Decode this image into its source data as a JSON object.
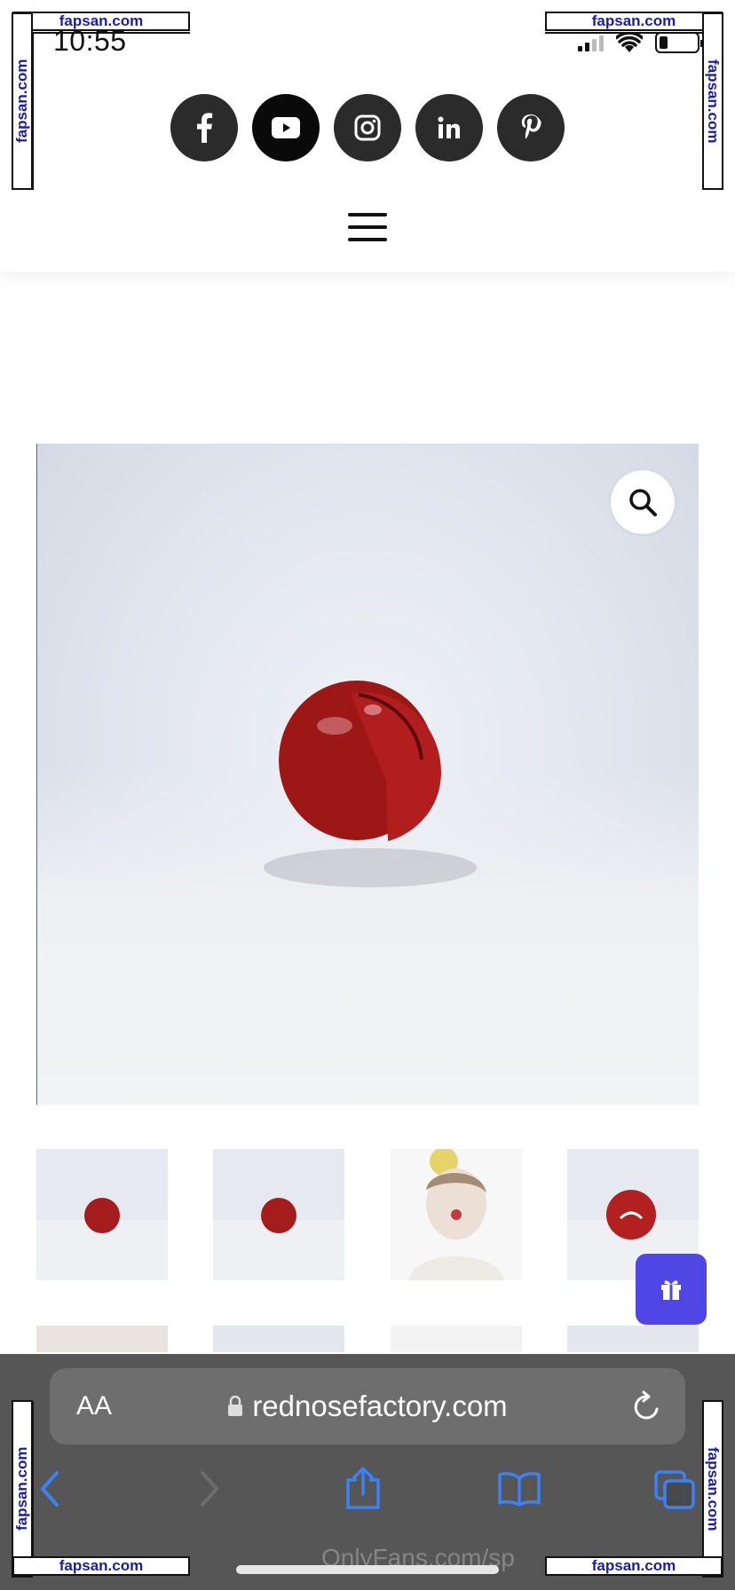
{
  "status_bar": {
    "time": "10:55"
  },
  "header": {
    "social_links": [
      {
        "name": "facebook-icon",
        "label": "f"
      },
      {
        "name": "youtube-icon",
        "label": ""
      },
      {
        "name": "instagram-icon",
        "label": ""
      },
      {
        "name": "linkedin-icon",
        "label": "in"
      },
      {
        "name": "pinterest-icon",
        "label": ""
      }
    ],
    "menu_icon": "hamburger-menu-icon"
  },
  "product": {
    "zoom_icon": "magnifier-icon",
    "thumbnails": [
      {
        "subject": "red-nose"
      },
      {
        "subject": "red-nose"
      },
      {
        "subject": "person-with-red-nose"
      },
      {
        "subject": "red-nose"
      }
    ]
  },
  "gift_button": {
    "icon": "gift-icon",
    "color": "#4f46e5"
  },
  "browser": {
    "text_size_label": "AA",
    "url": "rednosefactory.com",
    "watermark_text": "OnlyFans.com/sp"
  },
  "watermark": {
    "text": "fapsan.com",
    "color": "#1c1cab"
  }
}
